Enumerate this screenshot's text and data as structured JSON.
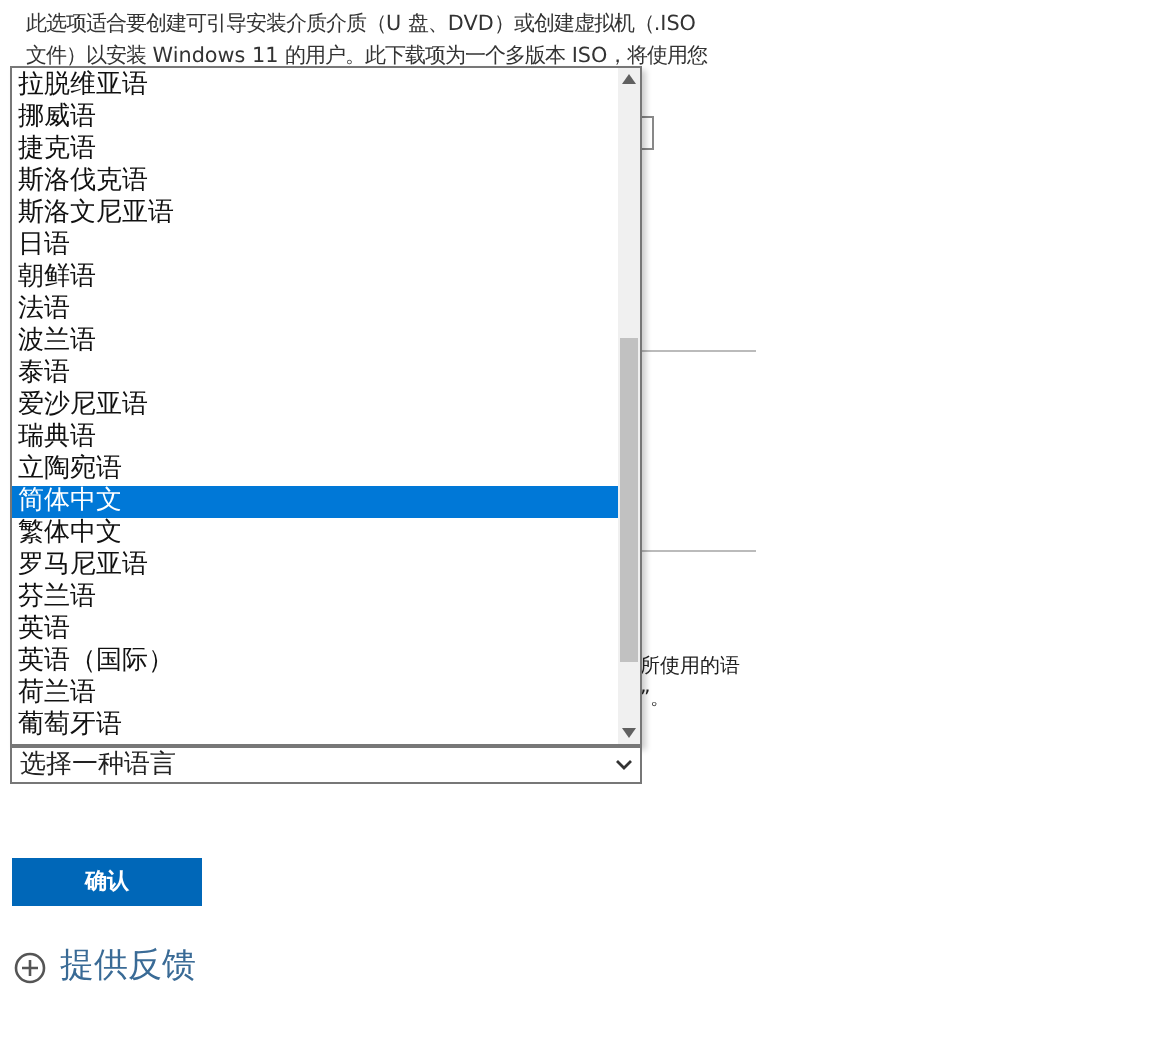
{
  "intro_lines": [
    "此选项适合要创建可引导安装介质介质（U 盘、DVD）或创建虚拟机（.ISO",
    "文件）以安装 Windows 11 的用户。此下载项为一个多版本 ISO，将使用您"
  ],
  "background_fragments": [
    "所使用的语",
    "”。"
  ],
  "language_list": {
    "items": [
      {
        "label": "拉脱维亚语",
        "selected": false
      },
      {
        "label": "挪威语",
        "selected": false
      },
      {
        "label": "捷克语",
        "selected": false
      },
      {
        "label": "斯洛伐克语",
        "selected": false
      },
      {
        "label": "斯洛文尼亚语",
        "selected": false
      },
      {
        "label": "日语",
        "selected": false
      },
      {
        "label": "朝鲜语",
        "selected": false
      },
      {
        "label": "法语",
        "selected": false
      },
      {
        "label": "波兰语",
        "selected": false
      },
      {
        "label": "泰语",
        "selected": false
      },
      {
        "label": "爱沙尼亚语",
        "selected": false
      },
      {
        "label": "瑞典语",
        "selected": false
      },
      {
        "label": "立陶宛语",
        "selected": false
      },
      {
        "label": "简体中文",
        "selected": true
      },
      {
        "label": "繁体中文",
        "selected": false
      },
      {
        "label": "罗马尼亚语",
        "selected": false
      },
      {
        "label": "芬兰语",
        "selected": false
      },
      {
        "label": "英语",
        "selected": false
      },
      {
        "label": "英语（国际）",
        "selected": false
      },
      {
        "label": "荷兰语",
        "selected": false
      },
      {
        "label": "葡萄牙语",
        "selected": false
      }
    ]
  },
  "language_select": {
    "value": "选择一种语言"
  },
  "confirm_button": "确认",
  "feedback_link": "提供反馈"
}
